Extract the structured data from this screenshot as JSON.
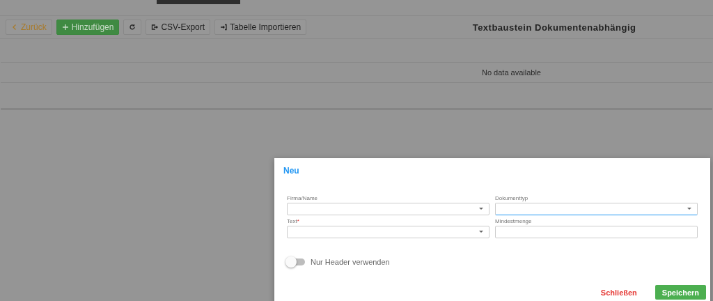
{
  "toolbar": {
    "buttons": [
      {
        "kind": "back",
        "label": "Zurück"
      },
      {
        "kind": "add",
        "label": "Hinzufügen"
      },
      {
        "kind": "refresh"
      },
      {
        "kind": "export",
        "label": "CSV-Export"
      },
      {
        "kind": "import",
        "label": "Tabelle Importieren"
      }
    ],
    "title": "Textbaustein Dokumentenabhängig"
  },
  "table": {
    "empty_message": "No data available"
  },
  "dialog": {
    "title": "Neu",
    "fields": [
      {
        "kind": "select",
        "label": "Firma/Name",
        "focused": false
      },
      {
        "kind": "select",
        "label": "Dokumenttyp",
        "focused": true
      },
      {
        "kind": "select",
        "label": "Text",
        "required_mark": "*",
        "focused": false
      },
      {
        "kind": "input",
        "label": "Mindestmenge",
        "focused": false
      }
    ],
    "toggle": {
      "label": "Nur Header verwenden",
      "on": false
    },
    "buttons": [
      {
        "kind": "text",
        "label": "Schließen"
      },
      {
        "kind": "primary",
        "label": "Speichern"
      }
    ]
  }
}
